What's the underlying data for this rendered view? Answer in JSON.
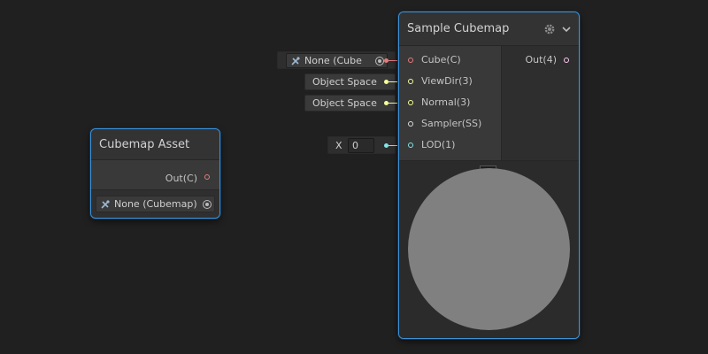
{
  "colors": {
    "background": "#202020",
    "node_border": "#3f91d6",
    "cube_port": "#e27c7c",
    "vector3_port": "#f6ff9a",
    "vector1_port": "#84e4e7",
    "sampler_port": "#dddddd",
    "vector4_port": "#fbcbf4",
    "preview_fill": "#808080"
  },
  "cubemap_asset_node": {
    "title": "Cubemap Asset",
    "output_label": "Out(C)",
    "field_value": "None (Cubemap)",
    "field_icon": "cubemap-object-icon"
  },
  "sample_cubemap_node": {
    "title": "Sample Cubemap",
    "settings_icon": "gear-icon",
    "collapse_icon": "chevron-down-icon",
    "inputs": [
      {
        "label": "Cube(C)",
        "port_color": "#e27c7c"
      },
      {
        "label": "ViewDir(3)",
        "port_color": "#f6ff9a"
      },
      {
        "label": "Normal(3)",
        "port_color": "#f6ff9a"
      },
      {
        "label": "Sampler(SS)",
        "port_color": "#dddddd"
      },
      {
        "label": "LOD(1)",
        "port_color": "#84e4e7"
      }
    ],
    "output_label": "Out(4)",
    "preview_toggle_icon": "chevron-up-icon"
  },
  "input_fields": {
    "cube_field_value": "None (Cube",
    "viewdir_value": "Object Space",
    "normal_value": "Object Space",
    "lod_axis_label": "X",
    "lod_value": "0"
  }
}
